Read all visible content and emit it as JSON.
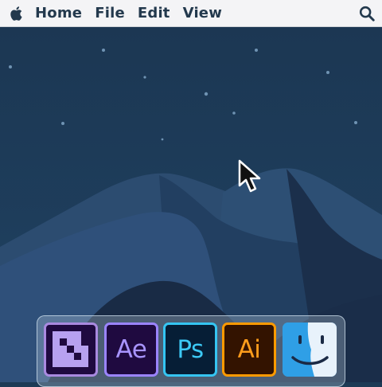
{
  "menubar": {
    "apple_icon": "apple-logo-icon",
    "items": [
      {
        "label": "Home"
      },
      {
        "label": "File"
      },
      {
        "label": "Edit"
      },
      {
        "label": "View"
      }
    ],
    "search_icon": "magnifier-icon"
  },
  "desktop": {
    "wallpaper": "night desert dunes",
    "colors": {
      "sky": "#1d3a55",
      "dune_light": "#2d4f74",
      "dune_dark": "#192c47"
    }
  },
  "dock": {
    "apps": [
      {
        "name": "Media Encoder",
        "icon": "media-encoder-icon",
        "label": "",
        "border": "#a98ae0"
      },
      {
        "name": "After Effects",
        "icon": "after-effects-icon",
        "label": "Ae",
        "border": "#9b84ff"
      },
      {
        "name": "Photoshop",
        "icon": "photoshop-icon",
        "label": "Ps",
        "border": "#35c5f2"
      },
      {
        "name": "Illustrator",
        "icon": "illustrator-icon",
        "label": "Ai",
        "border": "#ff9a00"
      },
      {
        "name": "Finder",
        "icon": "finder-icon",
        "label": ""
      }
    ]
  }
}
